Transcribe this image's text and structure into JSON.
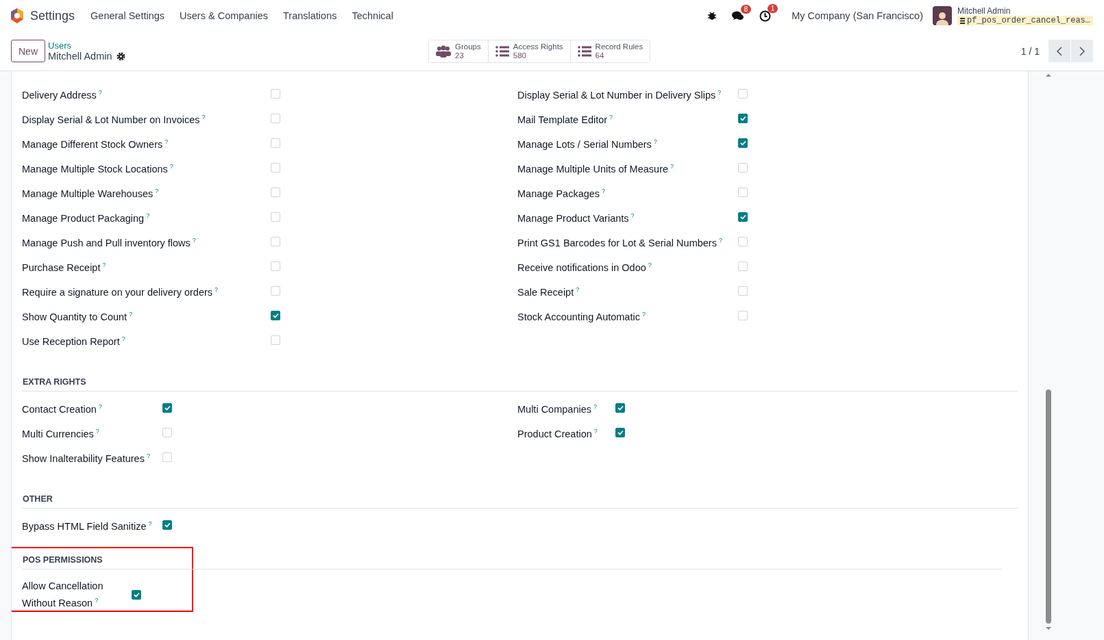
{
  "navbar": {
    "app": "Settings",
    "menu": [
      "General Settings",
      "Users & Companies",
      "Translations",
      "Technical"
    ],
    "chat_badge": "8",
    "activity_badge": "1",
    "company": "My Company (San Francisco)",
    "user": "Mitchell Admin",
    "database": "pf_pos_order_cancel_reas…"
  },
  "control_panel": {
    "new_button": "New",
    "breadcrumb": "Users",
    "record": "Mitchell Admin",
    "stats": [
      {
        "kind": "groups",
        "label": "Groups",
        "value": "23"
      },
      {
        "kind": "list",
        "label": "Access Rights",
        "value": "580"
      },
      {
        "kind": "list",
        "label": "Record Rules",
        "value": "64"
      }
    ],
    "pager": "1 / 1"
  },
  "sections": [
    {
      "kind": "wide",
      "columns": [
        [
          {
            "label": "Delivery Address",
            "help": "?",
            "checked": false
          },
          {
            "label": "Display Serial & Lot Number on Invoices",
            "help": "?",
            "checked": false
          },
          {
            "label": "Manage Different Stock Owners",
            "help": "?",
            "checked": false
          },
          {
            "label": "Manage Multiple Stock Locations",
            "help": "?",
            "checked": false
          },
          {
            "label": "Manage Multiple Warehouses",
            "help": "?",
            "checked": false
          },
          {
            "label": "Manage Product Packaging",
            "help": "?",
            "checked": false
          },
          {
            "label": "Manage Push and Pull inventory flows",
            "help": "?",
            "checked": false
          },
          {
            "label": "Purchase Receipt",
            "help": "?",
            "checked": false
          },
          {
            "label": "Require a signature on your delivery orders",
            "help": "?",
            "checked": false
          },
          {
            "label": "Show Quantity to Count",
            "help": "?",
            "checked": true
          },
          {
            "label": "Use Reception Report",
            "help": "?",
            "checked": false
          }
        ],
        [
          {
            "label": "Display Serial & Lot Number in Delivery Slips",
            "help": "?",
            "checked": false
          },
          {
            "label": "Mail Template Editor",
            "help": "?",
            "checked": true
          },
          {
            "label": "Manage Lots / Serial Numbers",
            "help": "?",
            "checked": true
          },
          {
            "label": "Manage Multiple Units of Measure",
            "help": "?",
            "checked": false
          },
          {
            "label": "Manage Packages",
            "help": "?",
            "checked": false
          },
          {
            "label": "Manage Product Variants",
            "help": "?",
            "checked": true
          },
          {
            "label": "Print GS1 Barcodes for Lot & Serial Numbers",
            "help": "?",
            "checked": false
          },
          {
            "label": "Receive notifications in Odoo",
            "help": "?",
            "checked": false
          },
          {
            "label": "Sale Receipt",
            "help": "?",
            "checked": false
          },
          {
            "label": "Stock Accounting Automatic",
            "help": "?",
            "checked": false
          }
        ]
      ]
    },
    {
      "kind": "narrow",
      "title": "EXTRA RIGHTS",
      "columns": [
        [
          {
            "label": "Contact Creation",
            "help": "?",
            "checked": true
          },
          {
            "label": "Multi Currencies",
            "help": "?",
            "checked": false
          },
          {
            "label": "Show Inalterability Features",
            "help": "?",
            "checked": false
          }
        ],
        [
          {
            "label": "Multi Companies",
            "help": "?",
            "checked": true
          },
          {
            "label": "Product Creation",
            "help": "?",
            "checked": true
          }
        ]
      ]
    },
    {
      "kind": "narrow",
      "title": "OTHER",
      "columns": [
        [
          {
            "label": "Bypass HTML Field Sanitize",
            "help": "?",
            "checked": true
          }
        ]
      ]
    },
    {
      "kind": "stacked",
      "title": "POS PERMISSIONS",
      "highlighted": true,
      "columns": [
        [
          {
            "label": "Allow Cancellation Without Reason",
            "help": "?",
            "checked": true
          }
        ]
      ]
    }
  ]
}
